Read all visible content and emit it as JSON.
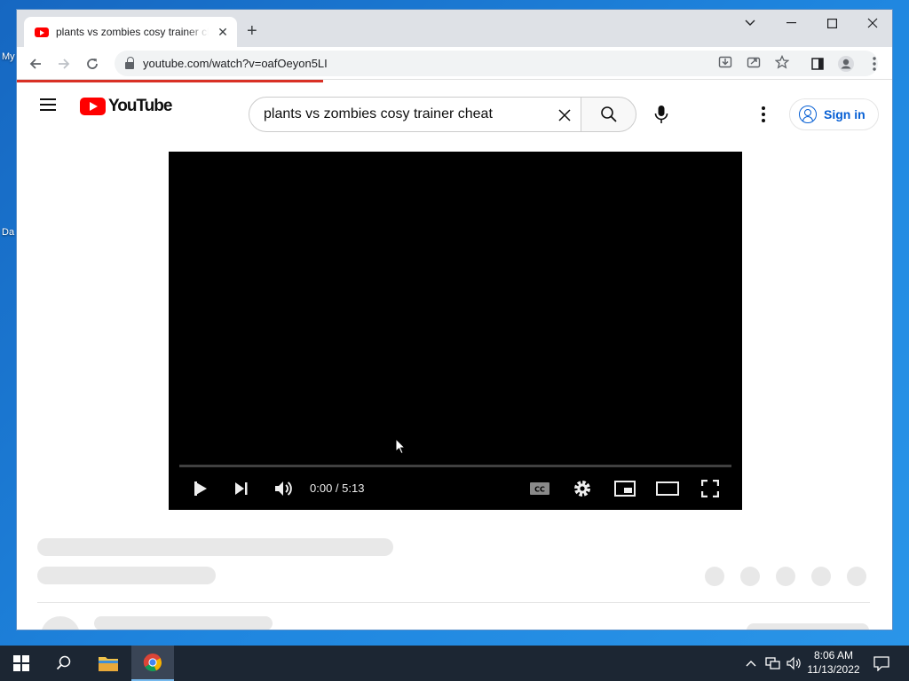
{
  "desktop": {
    "labels": [
      "My",
      "Da"
    ]
  },
  "browser": {
    "tab_title": "plants vs zombies cosy trainer cheat - YouTube",
    "new_tab_symbol": "+",
    "url": "youtube.com/watch?v=oafOeyon5LI"
  },
  "youtube": {
    "logo_text": "YouTube",
    "search_query": "plants vs zombies cosy trainer cheat",
    "sign_in_label": "Sign in",
    "player": {
      "time": "0:00 / 5:13",
      "progress": 0
    }
  },
  "taskbar": {
    "time": "8:06 AM",
    "date": "11/13/2022"
  },
  "colors": {
    "youtube_red": "#ff0000",
    "link_blue": "#065fd4",
    "desktop_blue": "#1f86df",
    "taskbar": "#1c2633"
  }
}
